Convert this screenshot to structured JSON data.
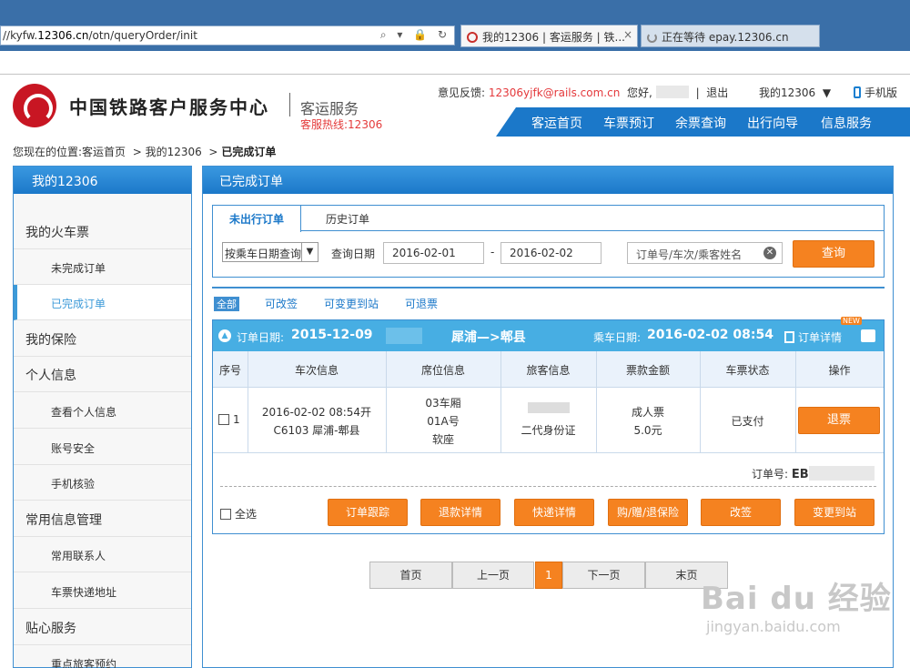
{
  "browser": {
    "url_prefix": "//kyfw.",
    "url_host": "12306.cn",
    "url_path": "/otn/queryOrder/init",
    "addr_icons": "⌕ ▾ 🔒 ↻",
    "tabs": [
      {
        "title": "我的12306 | 客运服务 | 铁...",
        "close": "×"
      },
      {
        "title": "正在等待 epay.12306.cn"
      }
    ]
  },
  "header": {
    "logo_title": "中国铁路客户服务中心",
    "logo_sub": "客运服务",
    "hotline": "客服热线:12306",
    "feedback_label": "意见反馈:",
    "feedback_email": "12306yjfk@rails.com.cn",
    "greeting": "您好,",
    "logout": "退出",
    "my12306": "我的12306",
    "mobile": "手机版",
    "nav": [
      "客运首页",
      "车票预订",
      "余票查询",
      "出行向导",
      "信息服务"
    ]
  },
  "breadcrumb": {
    "prefix": "您现在的位置:",
    "items": [
      "客运首页",
      "我的12306"
    ],
    "current": "已完成订单",
    "sep": ">"
  },
  "sidebar": {
    "title": "我的12306",
    "items": [
      {
        "label": "我的火车票"
      },
      {
        "label": "未完成订单"
      },
      {
        "label": "已完成订单"
      },
      {
        "label": "我的保险"
      },
      {
        "label": "个人信息"
      },
      {
        "label": "查看个人信息"
      },
      {
        "label": "账号安全"
      },
      {
        "label": "手机核验"
      },
      {
        "label": "常用信息管理"
      },
      {
        "label": "常用联系人"
      },
      {
        "label": "车票快递地址"
      },
      {
        "label": "贴心服务"
      },
      {
        "label": "重点旅客预约"
      }
    ]
  },
  "main": {
    "title": "已完成订单",
    "tabs": [
      "未出行订单",
      "历史订单"
    ],
    "date_type": "按乘车日期查询",
    "query_label": "查询日期",
    "start_date": "2016-02-01",
    "dash": "-",
    "end_date": "2016-02-02",
    "search_placeholder": "订单号/车次/乘客姓名",
    "query_button": "查询",
    "filters": [
      "全部",
      "可改签",
      "可变更到站",
      "可退票"
    ]
  },
  "order": {
    "order_date_label": "订单日期:",
    "order_date": "2015-12-09",
    "route": "犀浦—>郫县",
    "travel_date_label": "乘车日期:",
    "travel_date": "2016-02-02 08:54",
    "detail_link": "订单详情",
    "new_badge": "NEW",
    "columns": [
      "序号",
      "车次信息",
      "席位信息",
      "旅客信息",
      "票款金额",
      "车票状态",
      "操作"
    ],
    "row": {
      "index": "1",
      "train_time": "2016-02-02 08:54开",
      "train_route": "C6103 犀浦-郫县",
      "car": "03车厢",
      "seat": "01A号",
      "seat_type": "软座",
      "id_type": "二代身份证",
      "ticket_type": "成人票",
      "price": "5.0元",
      "status": "已支付",
      "refund": "退票"
    },
    "order_no_label": "订单号:",
    "order_no_prefix": "EB",
    "select_all": "全选",
    "actions": [
      "订单跟踪",
      "退款详情",
      "快递详情",
      "购/赠/退保险",
      "改签",
      "变更到站"
    ]
  },
  "pager": {
    "first": "首页",
    "prev": "上一页",
    "current": "1",
    "next": "下一页",
    "last": "末页"
  },
  "watermark": {
    "big": "Bai du 经验",
    "small": "jingyan.baidu.com"
  },
  "colors": {
    "blue": "#1b78c9",
    "orange": "#f58220",
    "red": "#c81623"
  }
}
